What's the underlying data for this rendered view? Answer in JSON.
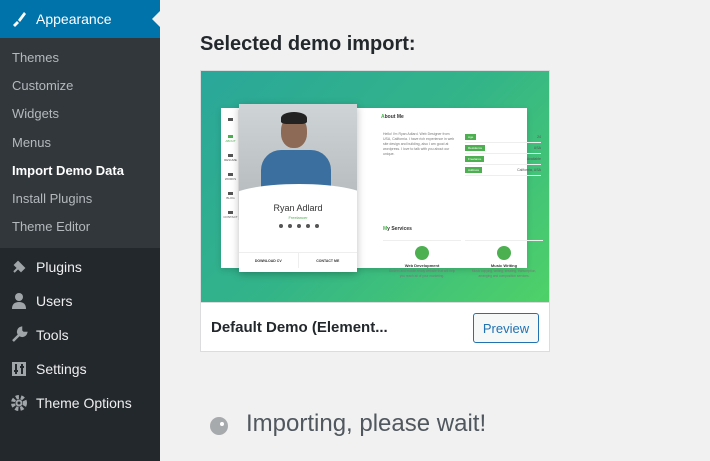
{
  "sidebar": {
    "active_item": {
      "label": "Appearance",
      "icon": "paintbrush-icon"
    },
    "submenu": [
      {
        "label": "Themes"
      },
      {
        "label": "Customize"
      },
      {
        "label": "Widgets"
      },
      {
        "label": "Menus"
      },
      {
        "label": "Import Demo Data",
        "current": true
      },
      {
        "label": "Install Plugins"
      },
      {
        "label": "Theme Editor"
      }
    ],
    "items": [
      {
        "label": "Plugins",
        "icon": "plugin-icon"
      },
      {
        "label": "Users",
        "icon": "users-icon"
      },
      {
        "label": "Tools",
        "icon": "wrench-icon"
      },
      {
        "label": "Settings",
        "icon": "settings-icon"
      },
      {
        "label": "Theme Options",
        "icon": "gear-icon"
      }
    ]
  },
  "main": {
    "section_title": "Selected demo import:",
    "demo": {
      "name": "Default Demo (Element...",
      "preview_label": "Preview",
      "screenshot": {
        "nav": [
          "ABOUT",
          "RESUME",
          "WORKS",
          "BLOG",
          "CONTACT"
        ],
        "person_name": "Ryan Adlard",
        "person_role": "Freelancer",
        "buttons": [
          "DOWNLOAD CV",
          "CONTACT ME"
        ],
        "about_heading_accent": "A",
        "about_heading_rest": "bout Me",
        "about_text": "Hello! I'm Ryan Adlard. Web Designer from USA, California. I have rich experience in web site design and building, also I am good at wordpress. I love to talk with you about our unique.",
        "info": [
          {
            "label": "Age",
            "value": "24"
          },
          {
            "label": "Residence",
            "value": "USA"
          },
          {
            "label": "Freelance",
            "value": "Available"
          },
          {
            "label": "Address",
            "value": "California, USA"
          }
        ],
        "services_heading_accent": "M",
        "services_heading_rest": "y Services",
        "services": [
          {
            "title": "Web Development",
            "desc": "Modern and mobile-ready website that will help you reach all of your marketing."
          },
          {
            "title": "Music Writing",
            "desc": "Music copying, writing, creating, transcription, arranging and composition services."
          }
        ]
      }
    },
    "status_text": "Importing, please wait!"
  }
}
